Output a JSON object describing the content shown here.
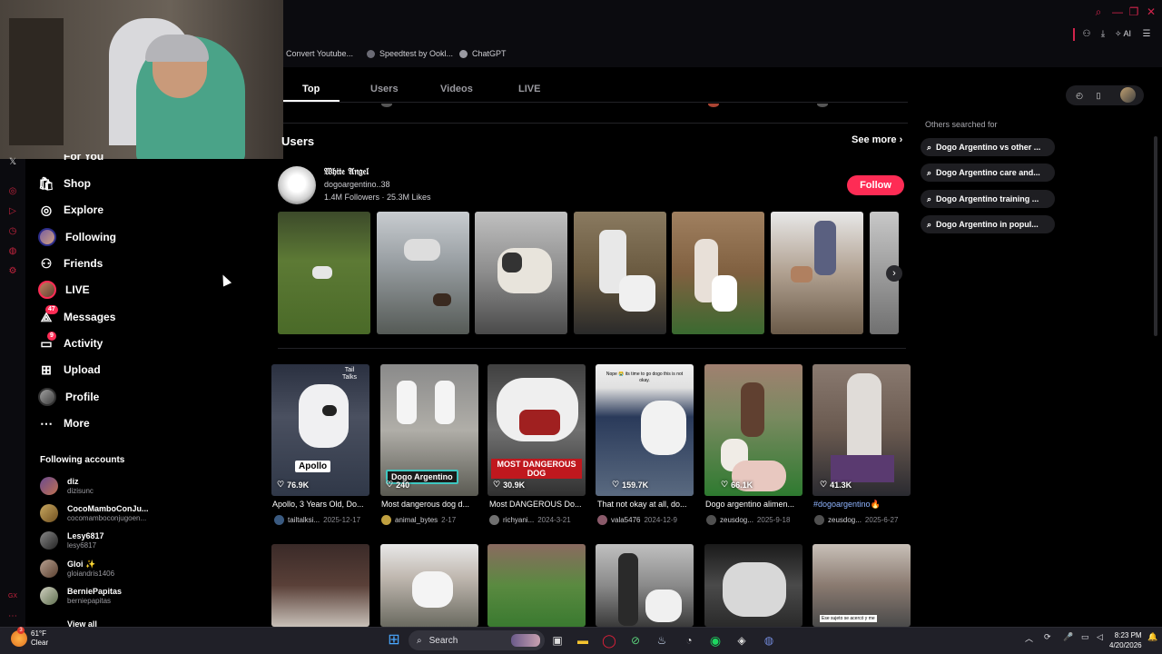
{
  "bookmarks": [
    {
      "label": "Convert Youtube..."
    },
    {
      "label": "Speedtest by Ookl..."
    },
    {
      "label": "ChatGPT"
    }
  ],
  "toolbar": {
    "ai_label": "AI"
  },
  "tabs": [
    {
      "label": "Top"
    },
    {
      "label": "Users"
    },
    {
      "label": "Videos"
    },
    {
      "label": "LIVE"
    }
  ],
  "sidebar": {
    "items": [
      {
        "label": "Shop",
        "icon": "shop-icon"
      },
      {
        "label": "Explore",
        "icon": "compass-icon"
      },
      {
        "label": "Following",
        "icon": "avatar-icon"
      },
      {
        "label": "Friends",
        "icon": "friends-icon"
      },
      {
        "label": "LIVE",
        "icon": "live-icon"
      },
      {
        "label": "Messages",
        "icon": "messages-icon",
        "badge": "47"
      },
      {
        "label": "Activity",
        "icon": "activity-icon",
        "badge": "9"
      },
      {
        "label": "Upload",
        "icon": "upload-icon"
      },
      {
        "label": "Profile",
        "icon": "profile-icon"
      },
      {
        "label": "More",
        "icon": "more-icon"
      }
    ],
    "following_title": "Following accounts",
    "following": [
      {
        "name": "diz",
        "handle": "dizisunc"
      },
      {
        "name": "CocoMamboConJu...",
        "handle": "cocomamboconjugoen..."
      },
      {
        "name": "Lesy6817",
        "handle": "lesy6817"
      },
      {
        "name": "Gloi ✨",
        "handle": "gloiandris1406"
      },
      {
        "name": "BerniePapitas",
        "handle": "berniepapitas"
      }
    ],
    "view_all": "View all"
  },
  "users_section": {
    "title": "Users",
    "see_more": "See more",
    "user": {
      "name": "𝔚𝔥𝔦𝔱𝔢 𝔄𝔫𝔤𝔢𝔩",
      "handle": "dogoargentino..38",
      "stats": "1.4M Followers  ·  25.3M Likes",
      "follow_label": "Follow"
    }
  },
  "videos": [
    {
      "likes": "76.9K",
      "title": "Apollo, 3 Years Old, Do...",
      "author": "tailtalksi...",
      "date": "2025-12-17",
      "overlay": "Apollo"
    },
    {
      "likes": "240",
      "title": "Most dangerous dog d...",
      "author": "animal_bytes",
      "date": "2-17",
      "overlay": "Dogo Argentino"
    },
    {
      "likes": "30.9K",
      "title": "Most DANGEROUS Do...",
      "author": "richyani...",
      "date": "2024-3-21",
      "overlay": "MOST DANGEROUS DOG"
    },
    {
      "likes": "159.7K",
      "title": "That not okay at all, do...",
      "author": "vala5476",
      "date": "2024-12-9",
      "overlay": "Nope 😭 its time to go dogo this is not okay."
    },
    {
      "likes": "66.1K",
      "title": "Dogo argentino alimen...",
      "author": "zeusdog...",
      "date": "2025-9-18",
      "overlay": ""
    },
    {
      "likes": "41.3K",
      "title": "#dogoargentino🔥",
      "author": "zeusdog...",
      "date": "2025-6-27",
      "overlay": ""
    }
  ],
  "video_row2_overlay": "Ese sujeto se acercó y me",
  "right_panel": {
    "title": "Others searched for",
    "chips": [
      "Dogo Argentino vs other ...",
      "Dogo Argentino care and...",
      "Dogo Argentino training ...",
      "Dogo Argentino in popul..."
    ]
  },
  "taskbar": {
    "search_label": "Search",
    "weather_temp": "61°F",
    "weather_desc": "Clear",
    "time": "8:23 PM",
    "date": "4/20/2026"
  },
  "colors": {
    "accent": "#fe2c55",
    "browser_accent": "#d1244b"
  }
}
